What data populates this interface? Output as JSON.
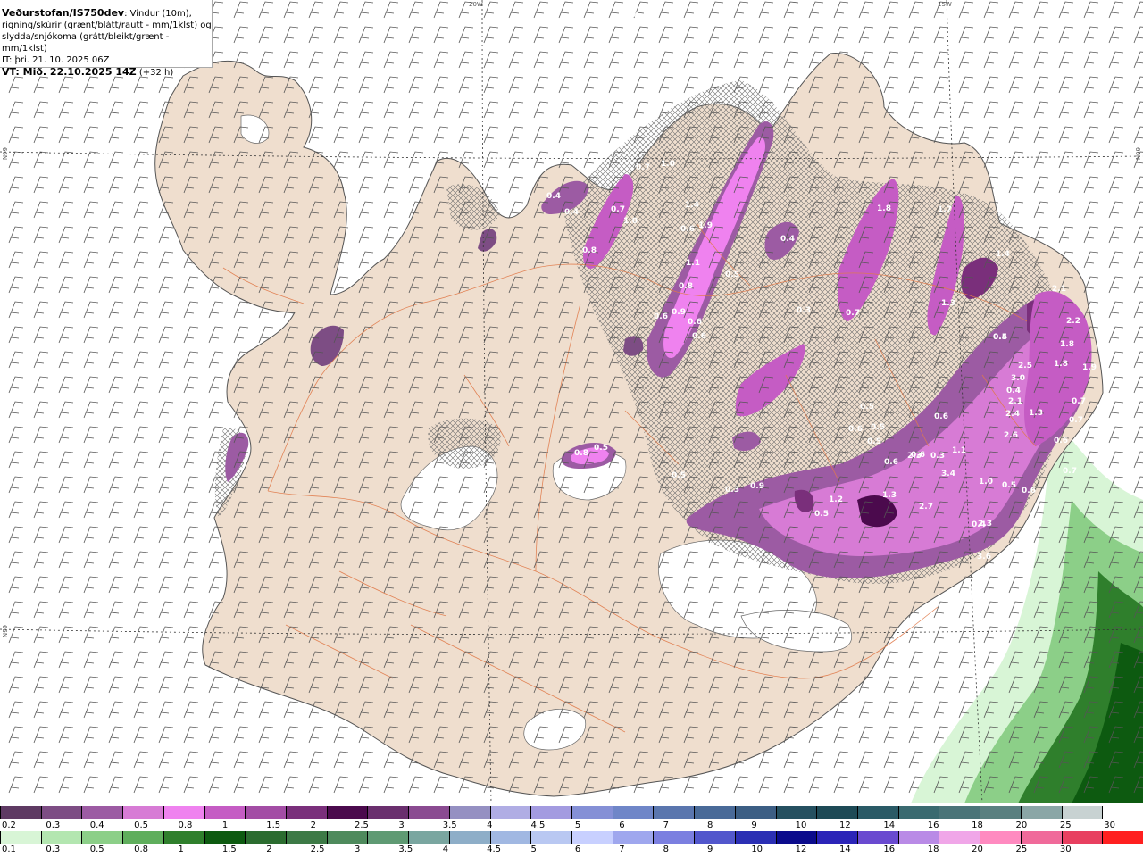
{
  "header": {
    "title_bold": "Veðurstofan/IS750dev",
    "title_rest": ": Vindur (10m),",
    "line2": "rigning/skúrir (grænt/blátt/rautt - mm/1klst) og",
    "line3": "slydda/snjókoma (grátt/bleikt/grænt - mm/1klst)",
    "line4": "IT: þri. 21. 10. 2025 06Z",
    "line5_bold": "VT: Mið. 22.10.2025 14Z",
    "line5_rest": " (+32 h)"
  },
  "grid_labels": {
    "lon1": "20W",
    "lon2": "15W",
    "lat1": "66N",
    "lat2": "65N",
    "lat1_right": "66N",
    "lat2_left": "65N"
  },
  "map_values": [
    "0.4",
    "0.7",
    "0.4",
    "0.4",
    "1.0",
    "0.8",
    "1.4",
    "0.7",
    "1.0",
    "1.9",
    "0.6",
    "1.1",
    "0.8",
    "0.9",
    "0.6",
    "0.6",
    "0.6",
    "0.5",
    "0.3",
    "0.4",
    "1.8",
    "1.7",
    "0.7",
    "1.3",
    "0.4",
    "2.1",
    "2.2",
    "1.8",
    "1.9",
    "2.5",
    "3.0",
    "1.8",
    "0.7",
    "0.7",
    "0.6",
    "2.1",
    "2.4",
    "1.3",
    "2.6",
    "0.5",
    "0.6",
    "0.5",
    "0.5",
    "0.6",
    "0.6",
    "0.6",
    "2.3",
    "0.3",
    "3.4",
    "1.0",
    "0.5",
    "0.6",
    "0.3",
    "0.9",
    "0.8",
    "0.5",
    "0.5",
    "1.2",
    "1.3",
    "2.7",
    "2.3",
    "0.5",
    "0.4",
    "1.1",
    "1.4",
    "0.4",
    "3.6",
    "0.5",
    "0.7"
  ],
  "legend_rain": {
    "colors": [
      "#5e3a63",
      "#7d4d84",
      "#9c5ba3",
      "#d77bd5",
      "#ef82ef",
      "#c55cc4",
      "#a34da5",
      "#7a2f7b",
      "#4b0a4d",
      "#6a2f6e",
      "#8a4b91",
      "#9590c2",
      "#b0ade4",
      "#a39be0",
      "#8590d6",
      "#6f86c8",
      "#5a76ae",
      "#496a98",
      "#3c5e84",
      "#255060",
      "#1e4a56",
      "#2a5a66",
      "#3a6a70",
      "#4a7478",
      "#5a8080",
      "#8aa6a6",
      "#c8d2d2",
      "#ffffff"
    ],
    "labels": [
      "0.2",
      "0.3",
      "0.4",
      "0.5",
      "0.8",
      "1",
      "1.5",
      "2",
      "2.5",
      "3",
      "3.5",
      "4",
      "4.5",
      "5",
      "6",
      "7",
      "8",
      "9",
      "10",
      "12",
      "14",
      "16",
      "18",
      "20",
      "25",
      "30"
    ]
  },
  "legend_snow": {
    "colors": [
      "#d8f5d6",
      "#b3e6b0",
      "#8ccf88",
      "#5fae5c",
      "#2f7f2c",
      "#0d5a10",
      "#2b6c2f",
      "#3d7a46",
      "#4e8a5c",
      "#5f9a73",
      "#7aa6a0",
      "#8eaec8",
      "#a1b8e2",
      "#b9c8f2",
      "#c8d0ff",
      "#9fa7ee",
      "#7b7fe0",
      "#5257cc",
      "#2b2fb4",
      "#0b0b8c",
      "#2b24b8",
      "#6a4ad0",
      "#b98ae6",
      "#f0a6e8",
      "#ff8ac0",
      "#f06a9a",
      "#e84060",
      "#ff2020"
    ],
    "labels": [
      "0.1",
      "0.3",
      "0.5",
      "0.8",
      "1",
      "1.5",
      "2",
      "2.5",
      "3",
      "3.5",
      "4",
      "4.5",
      "5",
      "6",
      "7",
      "8",
      "9",
      "10",
      "12",
      "14",
      "16",
      "18",
      "20",
      "25",
      "30"
    ]
  }
}
